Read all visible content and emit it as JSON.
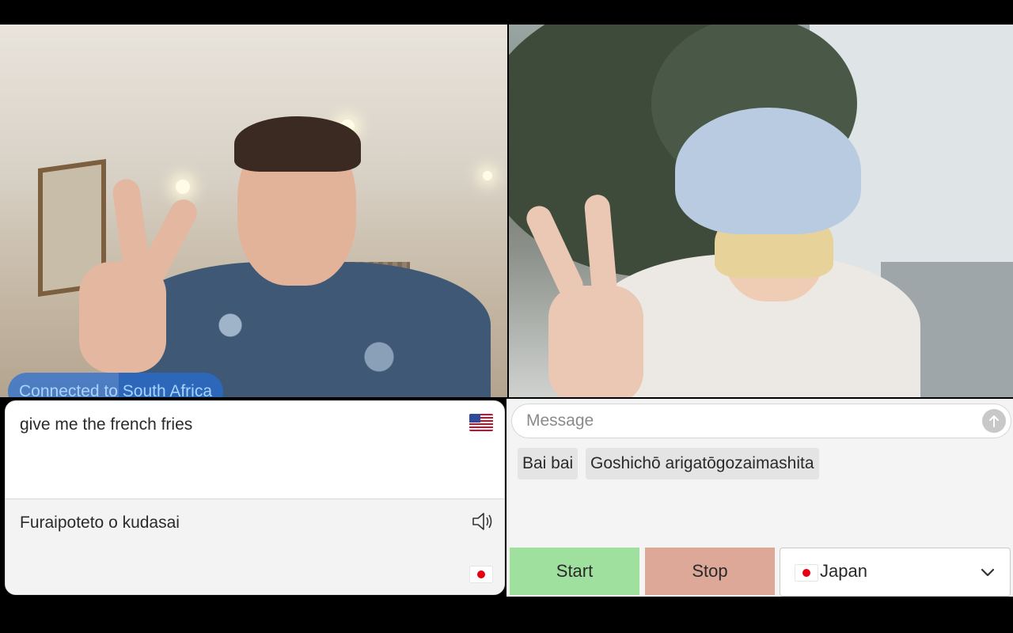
{
  "connection": {
    "status_text": "Connected to South Africa"
  },
  "translator": {
    "source_text": "give me the french fries",
    "source_flag_icon": "us-flag-icon",
    "translated_text": "Furaipoteto o kudasai",
    "target_flag_icon": "japan-flag-icon",
    "speaker_icon": "speaker-icon"
  },
  "chat": {
    "message_placeholder": "Message",
    "send_icon": "arrow-up-icon",
    "suggestions": [
      "Bai bai",
      "Goshichō arigatōgozaimashita"
    ]
  },
  "controls": {
    "start_label": "Start",
    "stop_label": "Stop",
    "country": "Japan",
    "start_color": "#9fe09f",
    "stop_color": "#dda897"
  },
  "colors": {
    "pill_bg": "#266ed2",
    "pill_text": "#a9d3ff"
  }
}
